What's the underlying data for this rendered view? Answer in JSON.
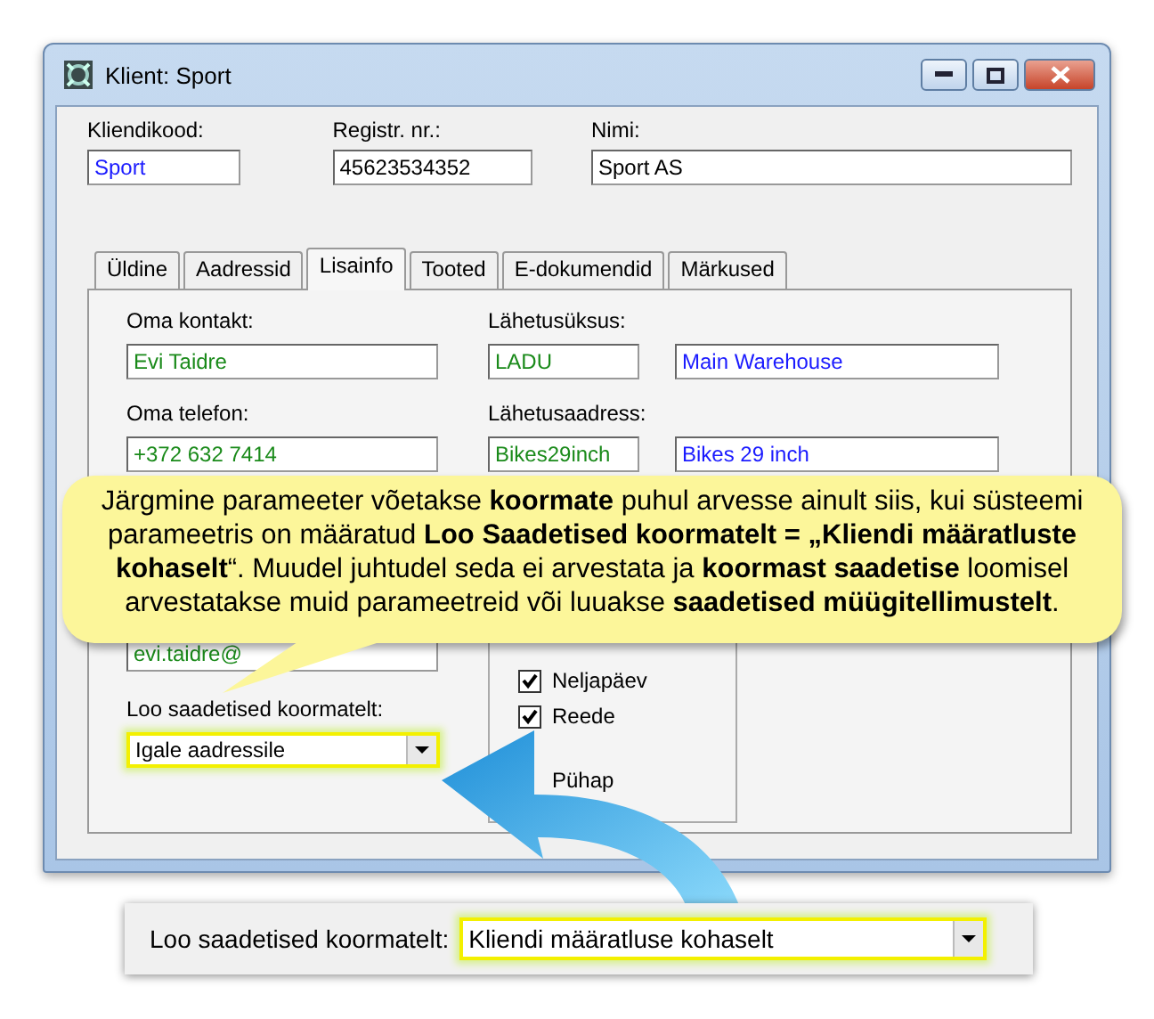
{
  "window": {
    "title": "Klient: Sport"
  },
  "header_fields": [
    {
      "label": "Kliendikood:",
      "value": "Sport",
      "color": "#1a1aff"
    },
    {
      "label": "Registr. nr.:",
      "value": "45623534352",
      "color": "#000000"
    },
    {
      "label": "Nimi:",
      "value": "Sport AS",
      "color": "#000000"
    }
  ],
  "tabs": [
    {
      "label": "Üldine",
      "selected": false
    },
    {
      "label": "Aadressid",
      "selected": false
    },
    {
      "label": "Lisainfo",
      "selected": true
    },
    {
      "label": "Tooted",
      "selected": false
    },
    {
      "label": "E-dokumendid",
      "selected": false
    },
    {
      "label": "Märkused",
      "selected": false
    }
  ],
  "contact": [
    {
      "label": "Oma kontakt:",
      "value": "Evi Taidre",
      "color": "#1a8a1a"
    },
    {
      "label": "Oma telefon:",
      "value": "+372 632 7414",
      "color": "#1a8a1a"
    },
    {
      "value": "evi.taidre@",
      "color": "#1a8a1a"
    }
  ],
  "shipping": [
    {
      "label": "Lähetusüksus:",
      "fields": [
        {
          "value": "LADU",
          "color": "#1a8a1a"
        },
        {
          "value": "Main Warehouse",
          "color": "#1a1aff"
        }
      ]
    },
    {
      "label": "Lähetusaadress:",
      "fields": [
        {
          "value": "Bikes29inch",
          "color": "#1a8a1a"
        },
        {
          "value": "Bikes 29 inch",
          "color": "#1a1aff"
        }
      ]
    }
  ],
  "load_combo": {
    "label": "Loo saadetised koormatelt:",
    "value": "Igale aadressile",
    "highlighted": true
  },
  "weekdays": [
    {
      "label": "Neljapäev",
      "checked": true
    },
    {
      "label": "Reede",
      "checked": true
    },
    {
      "label": "Pühap"
    }
  ],
  "callout": {
    "text": "Järgmine parameeter võetakse **koormate** puhul arvesse ainult siis, kui süsteemi parameetris on määratud **Loo Saadetised koormatelt = „Kliendi määratluste kohaselt**“. Muudel juhtudel seda ei arvestata ja **koormast saadetise** loomisel arvestatakse muid parameetreid või luuakse **saadetised müügitellimustelt**."
  },
  "inset": {
    "label": "Loo saadetised koormatelt:",
    "value": "Kliendi määratluse kohaselt",
    "highlighted": true
  }
}
